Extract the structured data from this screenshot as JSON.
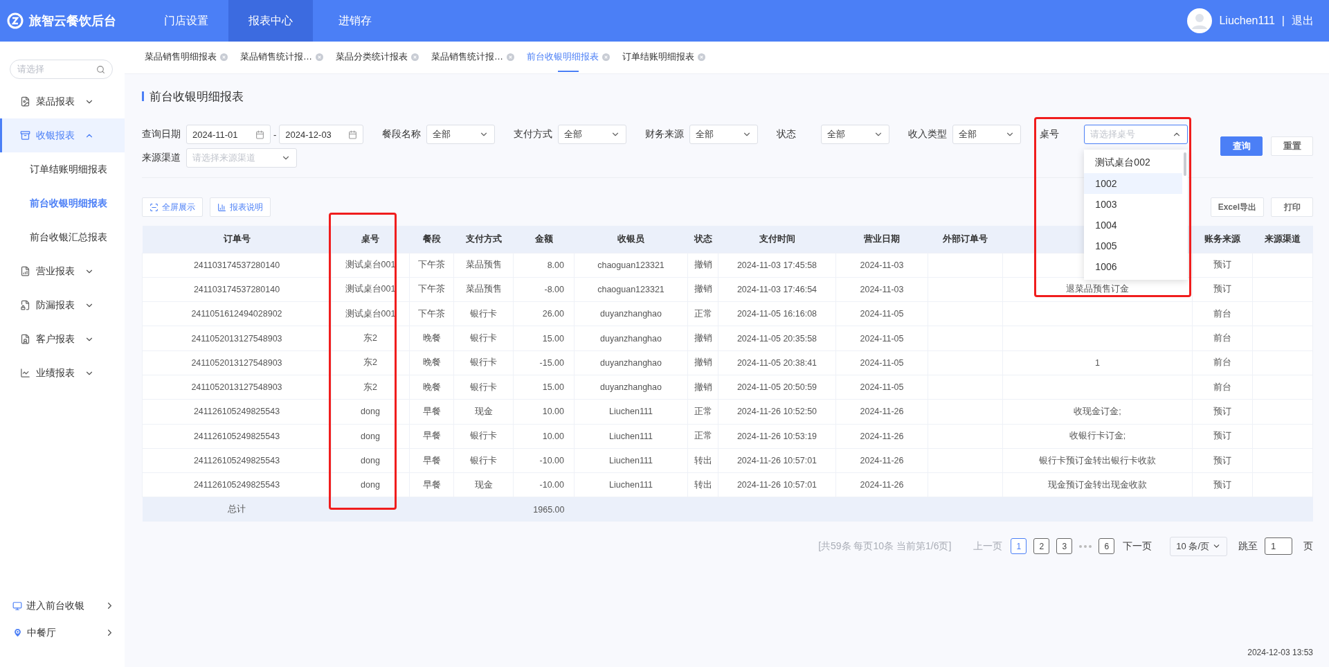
{
  "header": {
    "brand": "旅智云餐饮后台",
    "nav": [
      {
        "label": "门店设置",
        "selected": false
      },
      {
        "label": "报表中心",
        "selected": true
      },
      {
        "label": "进销存",
        "selected": false
      }
    ],
    "user": "Liuchen111",
    "separator": "|",
    "logout": "退出"
  },
  "tabs": [
    {
      "label": "菜品销售明细报表",
      "selected": false
    },
    {
      "label": "菜品销售统计报…",
      "selected": false
    },
    {
      "label": "菜品分类统计报表",
      "selected": false
    },
    {
      "label": "菜品销售统计报…",
      "selected": false
    },
    {
      "label": "前台收银明细报表",
      "selected": true
    },
    {
      "label": "订单结账明细报表",
      "selected": false
    }
  ],
  "sidebar": {
    "search_placeholder": "请选择",
    "items": [
      {
        "label": "菜品报表",
        "selected": false,
        "expanded": false
      },
      {
        "label": "收银报表",
        "selected": true,
        "expanded": true,
        "children": [
          {
            "label": "订单结账明细报表",
            "selected": false
          },
          {
            "label": "前台收银明细报表",
            "selected": true
          },
          {
            "label": "前台收银汇总报表",
            "selected": false
          }
        ]
      },
      {
        "label": "营业报表",
        "selected": false,
        "expanded": false
      },
      {
        "label": "防漏报表",
        "selected": false,
        "expanded": false
      },
      {
        "label": "客户报表",
        "selected": false,
        "expanded": false
      },
      {
        "label": "业绩报表",
        "selected": false,
        "expanded": false
      }
    ],
    "footer": [
      {
        "label": "进入前台收银"
      },
      {
        "label": "中餐厅"
      }
    ]
  },
  "page_title": "前台收银明细报表",
  "filters": [
    {
      "kind": "date-range",
      "label": "查询日期",
      "start": "2024-11-01",
      "separator": "-",
      "end": "2024-12-03"
    },
    {
      "kind": "select",
      "label": "餐段名称",
      "value": "全部",
      "expanded": false
    },
    {
      "kind": "select",
      "label": "支付方式",
      "value": "全部",
      "expanded": false
    },
    {
      "kind": "select",
      "label": "财务来源",
      "value": "全部",
      "expanded": false
    },
    {
      "kind": "select",
      "label": "状态",
      "value": "全部",
      "expanded": false
    },
    {
      "kind": "select",
      "label": "收入类型",
      "value": "全部",
      "expanded": false
    },
    {
      "kind": "select",
      "label": "桌号",
      "placeholder": "请选择桌号",
      "expanded": true,
      "options": [
        {
          "label": "测试桌台002",
          "selected": false
        },
        {
          "label": "1002",
          "selected": true
        },
        {
          "label": "1003",
          "selected": false
        },
        {
          "label": "1004",
          "selected": false
        },
        {
          "label": "1005",
          "selected": false
        },
        {
          "label": "1006",
          "selected": false
        }
      ]
    },
    {
      "kind": "select",
      "label": "来源渠道",
      "placeholder": "请选择来源渠道",
      "expanded": false
    }
  ],
  "query_buttons": [
    {
      "label": "查询",
      "kind": "primary"
    },
    {
      "label": "重置",
      "kind": "default"
    }
  ],
  "toolbar_left": [
    "全屏展示",
    "报表说明"
  ],
  "toolbar_right": [
    "Excel导出",
    "打印"
  ],
  "table": {
    "columns": {
      "order_no": "订单号",
      "table": "桌号",
      "meal": "餐段",
      "payment": "支付方式",
      "amount": "金额",
      "cashier": "收银员",
      "status": "状态",
      "pay_time": "支付时间",
      "business_date": "营业日期",
      "external_no": "外部订单号",
      "source": "账务来源",
      "channel": "来源渠道"
    },
    "rows": [
      {
        "order_no": "241103174537280140",
        "table": "测试桌台001",
        "meal": "下午茶",
        "payment": "菜品预售",
        "amount": "8.00",
        "cashier": "chaoguan123321",
        "status": "撤销",
        "pay_time": "2024-11-03 17:45:58",
        "business_date": "2024-11-03",
        "source": "预订"
      },
      {
        "order_no": "241103174537280140",
        "table": "测试桌台001",
        "meal": "下午茶",
        "payment": "菜品预售",
        "amount": "-8.00",
        "cashier": "chaoguan123321",
        "status": "撤销",
        "pay_time": "2024-11-03 17:46:54",
        "business_date": "2024-11-03",
        "remark": "退菜品预售订金",
        "source": "预订"
      },
      {
        "order_no": "2411051612494028902",
        "table": "测试桌台001",
        "meal": "下午茶",
        "payment": "银行卡",
        "amount": "26.00",
        "cashier": "duyanzhanghao",
        "status": "正常",
        "pay_time": "2024-11-05 16:16:08",
        "business_date": "2024-11-05",
        "source": "前台"
      },
      {
        "order_no": "2411052013127548903",
        "table": "东2",
        "meal": "晚餐",
        "payment": "银行卡",
        "amount": "15.00",
        "cashier": "duyanzhanghao",
        "status": "撤销",
        "pay_time": "2024-11-05 20:35:58",
        "business_date": "2024-11-05",
        "source": "前台"
      },
      {
        "order_no": "2411052013127548903",
        "table": "东2",
        "meal": "晚餐",
        "payment": "银行卡",
        "amount": "-15.00",
        "cashier": "duyanzhanghao",
        "status": "撤销",
        "pay_time": "2024-11-05 20:38:41",
        "business_date": "2024-11-05",
        "remark": "1",
        "source": "前台"
      },
      {
        "order_no": "2411052013127548903",
        "table": "东2",
        "meal": "晚餐",
        "payment": "银行卡",
        "amount": "15.00",
        "cashier": "duyanzhanghao",
        "status": "撤销",
        "pay_time": "2024-11-05 20:50:59",
        "business_date": "2024-11-05",
        "source": "前台"
      },
      {
        "order_no": "241126105249825543",
        "table": "dong",
        "meal": "早餐",
        "payment": "现金",
        "amount": "10.00",
        "cashier": "Liuchen111",
        "status": "正常",
        "pay_time": "2024-11-26 10:52:50",
        "business_date": "2024-11-26",
        "remark": "收现金订金;",
        "source": "预订"
      },
      {
        "order_no": "241126105249825543",
        "table": "dong",
        "meal": "早餐",
        "payment": "银行卡",
        "amount": "10.00",
        "cashier": "Liuchen111",
        "status": "正常",
        "pay_time": "2024-11-26 10:53:19",
        "business_date": "2024-11-26",
        "remark": "收银行卡订金;",
        "source": "预订"
      },
      {
        "order_no": "241126105249825543",
        "table": "dong",
        "meal": "早餐",
        "payment": "银行卡",
        "amount": "-10.00",
        "cashier": "Liuchen111",
        "status": "转出",
        "pay_time": "2024-11-26 10:57:01",
        "business_date": "2024-11-26",
        "remark": "银行卡预订金转出银行卡收款",
        "source": "预订"
      },
      {
        "order_no": "241126105249825543",
        "table": "dong",
        "meal": "早餐",
        "payment": "现金",
        "amount": "-10.00",
        "cashier": "Liuchen111",
        "status": "转出",
        "pay_time": "2024-11-26 10:57:01",
        "business_date": "2024-11-26",
        "remark": "现金预订金转出现金收款",
        "source": "预订"
      }
    ],
    "total": {
      "label": "总计",
      "amount": "1965.00"
    }
  },
  "pagination": {
    "summary": "[共59条 每页10条 当前第1/6页]",
    "prev": {
      "label": "上一页",
      "disabled": true
    },
    "pages": [
      {
        "kind": "page",
        "label": "1",
        "selected": true
      },
      {
        "kind": "page",
        "label": "2",
        "selected": false
      },
      {
        "kind": "page",
        "label": "3",
        "selected": false
      },
      {
        "kind": "ellipsis"
      },
      {
        "kind": "page",
        "label": "6",
        "selected": false
      }
    ],
    "next": {
      "label": "下一页",
      "disabled": false
    },
    "page_size": "10 条/页",
    "jump_label": "跳至",
    "jump_value": "1",
    "page_unit": "页"
  },
  "timestamp": "2024-12-03 13:53"
}
